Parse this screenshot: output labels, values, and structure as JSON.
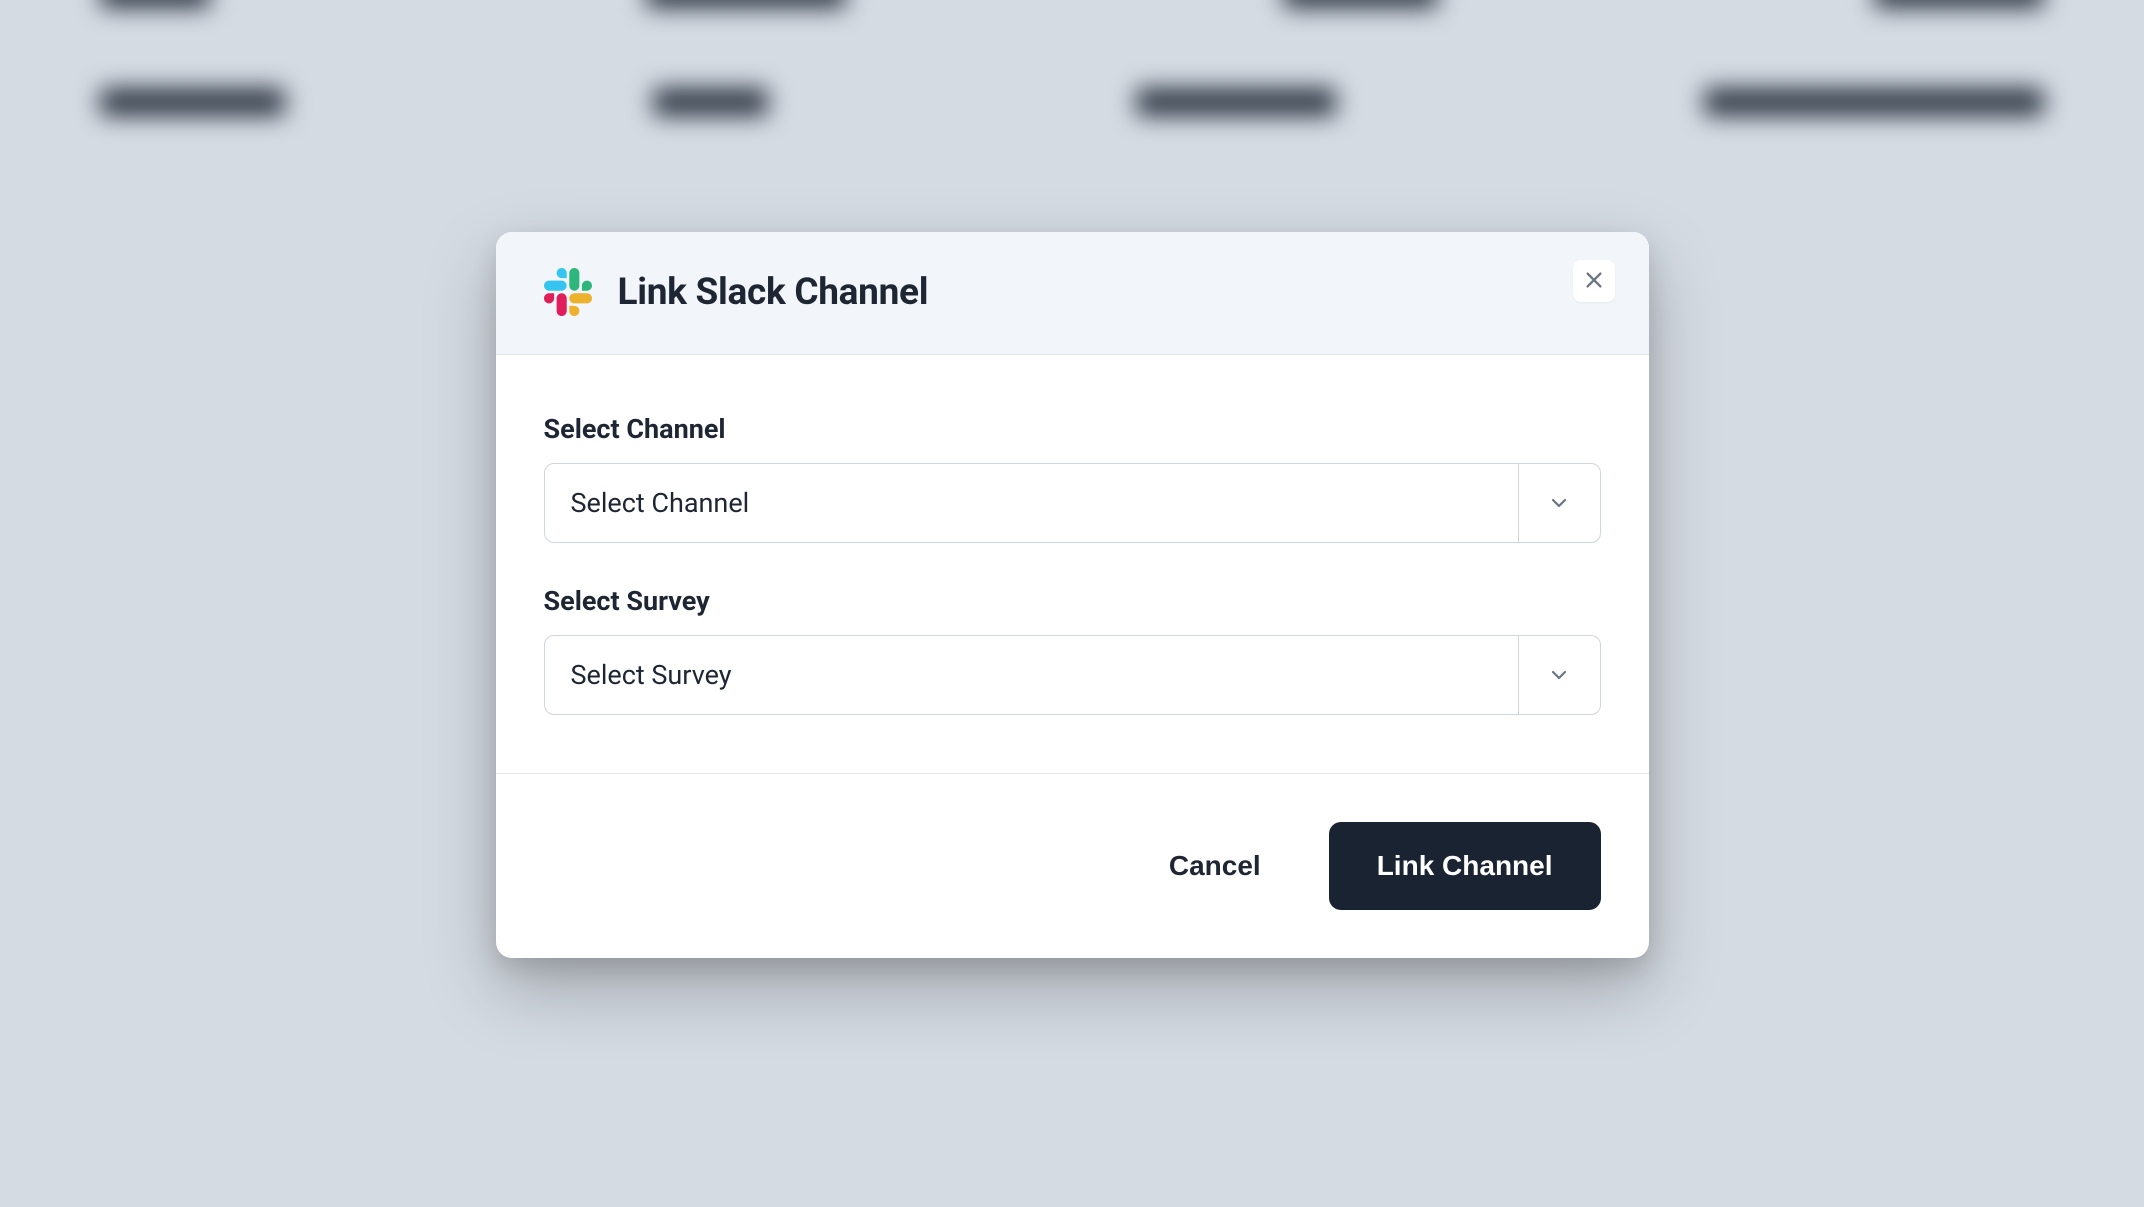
{
  "modal": {
    "title": "Link Slack Channel",
    "fields": {
      "channel": {
        "label": "Select Channel",
        "placeholder": "Select Channel"
      },
      "survey": {
        "label": "Select Survey",
        "placeholder": "Select Survey"
      }
    },
    "actions": {
      "cancel": "Cancel",
      "submit": "Link Channel"
    }
  }
}
